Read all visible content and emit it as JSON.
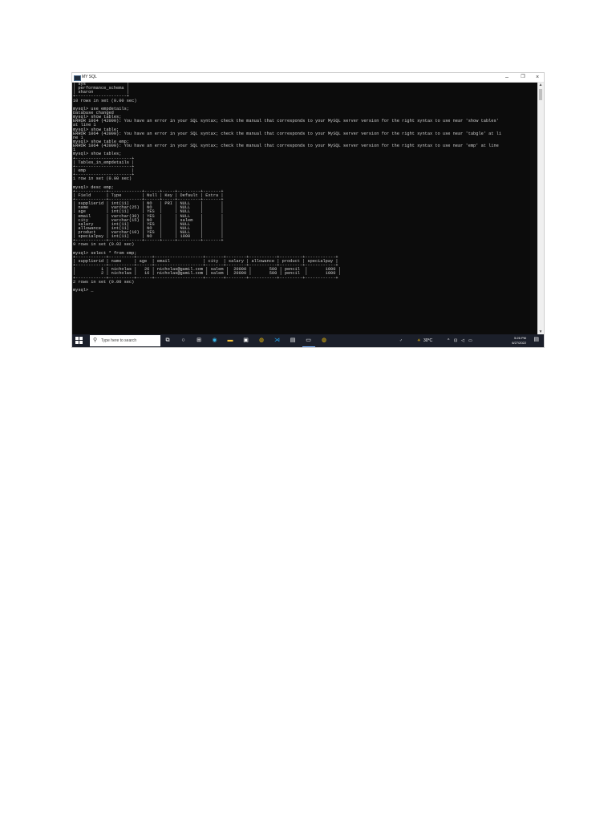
{
  "window": {
    "title": "MY SQL",
    "minimize_glyph": "–",
    "maximize_glyph": "❐",
    "close_glyph": "×"
  },
  "console": {
    "lines": [
      "| sys                |",
      "| performance_schema |",
      "| sharon             |",
      "+--------------------+",
      "10 rows in set (0.00 sec)",
      "",
      "mysql> use empdetails;",
      "Database changed",
      "mysql> show tables;",
      "ERROR 1064 (42000): You have an error in your SQL syntax; check the manual that corresponds to your MySQL server version for the right syntax to use near 'show tables'",
      "at line 1",
      "mysql> show table;",
      "ERROR 1064 (42000): You have an error in your SQL syntax; check the manual that corresponds to your MySQL server version for the right syntax to use near 'tabgle' at li",
      "ne 1",
      "mysql> show table emp;",
      "ERROR 1064 (42000): You have an error in your SQL syntax; check the manual that corresponds to your MySQL server version for the right syntax to use near 'emp' at line",
      "1",
      "mysql> show tables;",
      "+----------------------+",
      "| Tables_in_empdetails |",
      "+----------------------+",
      "| emp                  |",
      "+----------------------+",
      "1 row in set (0.00 sec)",
      "",
      "mysql> desc emp;",
      "+------------+-------------+------+-----+---------+-------+",
      "| Field      | Type        | Null | Key | Default | Extra |",
      "+------------+-------------+------+-----+---------+-------+",
      "| supplierid | int(11)     | NO   | PRI | NULL    |       |",
      "| name       | varchar(25) | NO   |     | NULL    |       |",
      "| age        | int(11)     | YES  |     | NULL    |       |",
      "| email      | varchar(30) | YES  |     | NULL    |       |",
      "| city       | varchar(15) | NO   |     | salem   |       |",
      "| salary     | int(11)     | YES  |     | NULL    |       |",
      "| allowance  | int(11)     | NO   |     | NULL    |       |",
      "| product    | varchar(10) | YES  |     | NULL    |       |",
      "| specialpay | int(11)     | NO   |     | 1000    |       |",
      "+------------+-------------+------+-----+---------+-------+",
      "9 rows in set (0.02 sec)",
      "",
      "mysql> select * from emp;",
      "+------------+----------+------+-------------------+-------+--------+-----------+---------+------------+",
      "| supplierid | name     | age  | email             | city  | salary | allowance | product | specialpay |",
      "+------------+----------+------+-------------------+-------+--------+-----------+---------+------------+",
      "|          1 | nicholas |   26 | nicholas@gamil.com | salem |  20000 |       500 | pencil  |       1000 |",
      "|          2 | nicholas |   16 | nicholas@gamil.com | salem |  20000 |       500 | pencil  |       1000 |",
      "+------------+----------+------+-------------------+-------+--------+-----------+---------+------------+",
      "2 rows in set (0.00 sec)",
      "",
      "mysql> _"
    ]
  },
  "scrollbar": {
    "up_glyph": "▲",
    "down_glyph": "▼"
  },
  "taskbar": {
    "search_placeholder": "Type here to search",
    "search_glyph": "⚲",
    "icons": [
      {
        "name": "task-view-icon",
        "glyph": "⧉",
        "color": "#ffffff"
      },
      {
        "name": "cortana-icon",
        "glyph": "○",
        "color": "#ffffff"
      },
      {
        "name": "widgets-icon",
        "glyph": "⊞",
        "color": "#ffffff"
      },
      {
        "name": "edge-icon",
        "glyph": "◉",
        "color": "#38b6e8"
      },
      {
        "name": "file-explorer-icon",
        "glyph": "▬",
        "color": "#f3c23c"
      },
      {
        "name": "store-icon",
        "glyph": "▣",
        "color": "#ffffff"
      },
      {
        "name": "chrome-icon",
        "glyph": "◍",
        "color": "#f4c20d"
      },
      {
        "name": "vscode-icon",
        "glyph": "⋊",
        "color": "#23a6f0"
      },
      {
        "name": "notepad-icon",
        "glyph": "▤",
        "color": "#ffffff"
      },
      {
        "name": "terminal-icon",
        "glyph": "▭",
        "color": "#ffffff"
      },
      {
        "name": "chrome-icon-2",
        "glyph": "◍",
        "color": "#f4c20d"
      }
    ],
    "tray": {
      "person_glyph": "♂",
      "weather_glyph": "☀",
      "temperature": "30°C",
      "chevron_glyph": "^",
      "network_glyph": "⊡",
      "volume_glyph": "◁",
      "battery_glyph": "▭",
      "notifications_glyph": "▤",
      "time": "5:26 PM",
      "date": "6/27/2022"
    }
  }
}
